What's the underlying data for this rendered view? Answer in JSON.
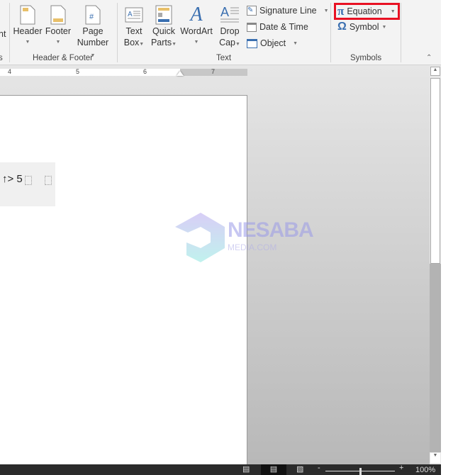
{
  "ribbon": {
    "partial_left_label": "nt",
    "partial_left_group": "s",
    "header_footer": {
      "group_label": "Header & Footer",
      "header": "Header",
      "footer": "Footer",
      "page_number_1": "Page",
      "page_number_2": "Number"
    },
    "text": {
      "group_label": "Text",
      "text_box_1": "Text",
      "text_box_2": "Box",
      "quick_parts_1": "Quick",
      "quick_parts_2": "Parts",
      "wordart": "WordArt",
      "drop_cap_1": "Drop",
      "drop_cap_2": "Cap",
      "signature_line": "Signature Line",
      "date_time": "Date & Time",
      "object": "Object"
    },
    "symbols": {
      "group_label": "Symbols",
      "equation": "Equation",
      "symbol": "Symbol",
      "equation_glyph": "π",
      "symbol_glyph": "Ω"
    },
    "highlight_color": "#e81123"
  },
  "ruler": {
    "marks": [
      "4",
      "5",
      "6",
      "7"
    ]
  },
  "document": {
    "equation_text": "↑> 5"
  },
  "watermark": {
    "brand": "NESABA",
    "sub": "MEDIA.COM"
  },
  "status": {
    "zoom": "100%"
  }
}
